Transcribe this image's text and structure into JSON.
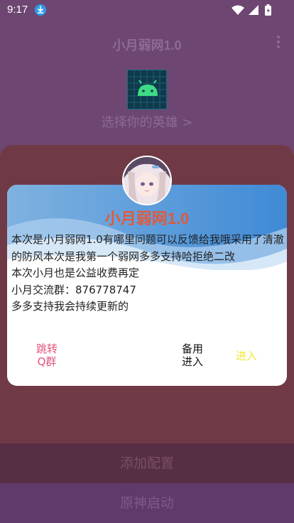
{
  "status": {
    "time": "9:17"
  },
  "appbar": {
    "title": "小月弱网1.0"
  },
  "main": {
    "hero_select": "选择你的英雄 >"
  },
  "dialog": {
    "title": "小月弱网1.0",
    "lines": [
      "本次是小月弱网1.0有哪里问题可以反馈给我哦采用了清澈的防风本次是我第一个弱网多多支持哈拒绝二改",
      "本次小月也是公益收费再定",
      "小月交流群：876778747",
      "多多支持我会持续更新的"
    ],
    "btn_group": "跳转Q群",
    "btn_backup": "备用进入",
    "btn_enter": "进入"
  },
  "buttons": {
    "add_config": "添加配置",
    "launch": "原神启动"
  },
  "colors": {
    "background": "#6d4672",
    "dialog_title": "#e05a3c",
    "btn_group": "#e2537a",
    "btn_enter": "#f3e63a",
    "dialog_wave": "#4a90d9"
  },
  "icons": [
    "download-badge-icon",
    "wifi-icon",
    "signal-icon",
    "battery-icon",
    "more-vert-icon",
    "android-icon",
    "avatar"
  ]
}
